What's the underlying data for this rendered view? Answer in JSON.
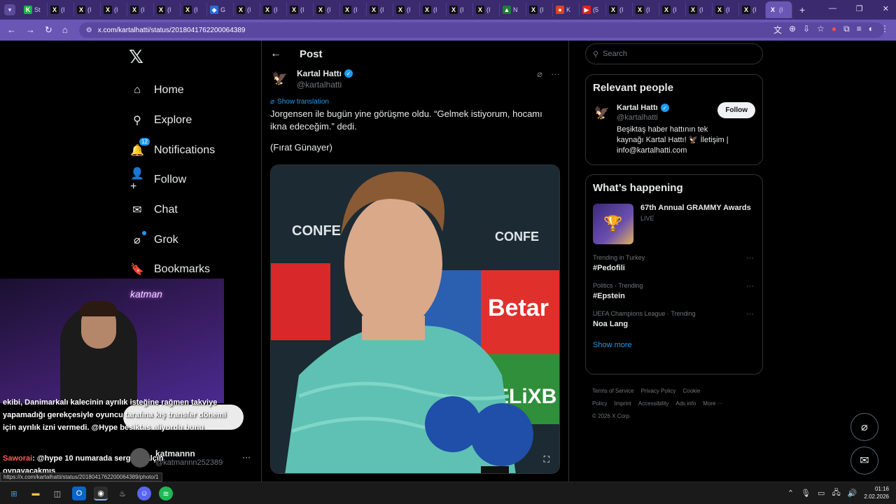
{
  "browser": {
    "tabs": [
      {
        "icon": "K",
        "color": "#1bb34a",
        "label": "St"
      },
      {
        "icon": "X",
        "color": "#111111",
        "label": "(I"
      },
      {
        "icon": "X",
        "color": "#111111",
        "label": "(I"
      },
      {
        "icon": "X",
        "color": "#111111",
        "label": "(I"
      },
      {
        "icon": "X",
        "color": "#111111",
        "label": "(I"
      },
      {
        "icon": "X",
        "color": "#111111",
        "label": "(I"
      },
      {
        "icon": "X",
        "color": "#111111",
        "label": "(I"
      },
      {
        "icon": "◆",
        "color": "#2a6bd8",
        "label": "G"
      },
      {
        "icon": "X",
        "color": "#111111",
        "label": "(I"
      },
      {
        "icon": "X",
        "color": "#111111",
        "label": "(I"
      },
      {
        "icon": "X",
        "color": "#111111",
        "label": "(I"
      },
      {
        "icon": "X",
        "color": "#111111",
        "label": "(I"
      },
      {
        "icon": "X",
        "color": "#111111",
        "label": "(I"
      },
      {
        "icon": "X",
        "color": "#111111",
        "label": "(I"
      },
      {
        "icon": "X",
        "color": "#111111",
        "label": "(I"
      },
      {
        "icon": "X",
        "color": "#111111",
        "label": "(I"
      },
      {
        "icon": "X",
        "color": "#111111",
        "label": "(I"
      },
      {
        "icon": "X",
        "color": "#111111",
        "label": "(I"
      },
      {
        "icon": "▲",
        "color": "#1e7d3b",
        "label": "N"
      },
      {
        "icon": "X",
        "color": "#111111",
        "label": "(I"
      },
      {
        "icon": "●",
        "color": "#d6452a",
        "label": "K"
      },
      {
        "icon": "▶",
        "color": "#e62117",
        "label": "(5"
      },
      {
        "icon": "X",
        "color": "#111111",
        "label": "(I"
      },
      {
        "icon": "X",
        "color": "#111111",
        "label": "(I"
      },
      {
        "icon": "X",
        "color": "#111111",
        "label": "(I"
      },
      {
        "icon": "X",
        "color": "#111111",
        "label": "(I"
      },
      {
        "icon": "X",
        "color": "#111111",
        "label": "(I"
      },
      {
        "icon": "X",
        "color": "#111111",
        "label": "(I"
      },
      {
        "icon": "X",
        "color": "#6a57b5",
        "label": "(I"
      }
    ],
    "url": "x.com/kartalhatti/status/2018041762200064389",
    "status_url": "https://x.com/kartalhatti/status/2018041762200064389/photo/1"
  },
  "nav": {
    "items": [
      {
        "icon": "⌂",
        "label": "Home"
      },
      {
        "icon": "⚲",
        "label": "Explore"
      },
      {
        "icon": "🔔",
        "label": "Notifications",
        "badge": "12"
      },
      {
        "icon": "👤+",
        "label": "Follow"
      },
      {
        "icon": "✉",
        "label": "Chat"
      },
      {
        "icon": "⌀",
        "label": "Grok"
      },
      {
        "icon": "🔖",
        "label": "Bookmarks"
      }
    ]
  },
  "post": {
    "header_title": "Post",
    "author_name": "Kartal Hattı",
    "author_handle": "@kartalhatti",
    "show_translation": "Show translation",
    "text_line1": "Jorgensen ile bugün yine görüşme oldu. “Gelmek istiyorum, hocamı ikna edeceğim.” dedi.",
    "text_line2": "(Fırat Günayer)"
  },
  "search": {
    "placeholder": "Search"
  },
  "relevant": {
    "title": "Relevant people",
    "name": "Kartal Hattı",
    "handle": "@kartalhatti",
    "bio": "Beşiktaş haber hattının tek kaynağı Kartal Hattı! 🦅 İletişim | info@kartalhatti.com",
    "follow_label": "Follow"
  },
  "happening": {
    "title": "What’s happening",
    "event_title": "67th Annual GRAMMY Awards",
    "event_status": "LIVE",
    "trends": [
      {
        "context": "Trending in Turkey",
        "name": "#Pedofili"
      },
      {
        "context": "Politics · Trending",
        "name": "#Epstein"
      },
      {
        "context": "UEFA Champions League · Trending",
        "name": "Noa Lang"
      }
    ],
    "show_more": "Show more"
  },
  "footer": {
    "links": [
      "Terms of Service",
      "Privacy Policy",
      "Cookie Policy",
      "Imprint",
      "Accessibility",
      "Ads info",
      "More ···"
    ],
    "copyright": "© 2026 X Corp."
  },
  "stream": {
    "neon_text": "katman",
    "chat_line1": "ekibi, Danimarkalı kalecinin ayrılık isteğine rağmen takviye yapamadığı gerekçesiyle oyuncu tarafına kış transfer dönemi için ayrılık izni vermedi. @Hype besiktas aliyordu bunu",
    "chat_sender": "Saworai",
    "chat_line2": ": @hype 10 numarada sergen yalçın oynayacakmış",
    "user_name": "katmannn",
    "user_handle": "@katmannn252389"
  },
  "taskbar": {
    "time": "01:16",
    "date": "2.02.2026"
  },
  "colors": {
    "accent": "#1d9bf0",
    "chrome": "#6a57b5",
    "tabbar": "#3b2a6e"
  }
}
